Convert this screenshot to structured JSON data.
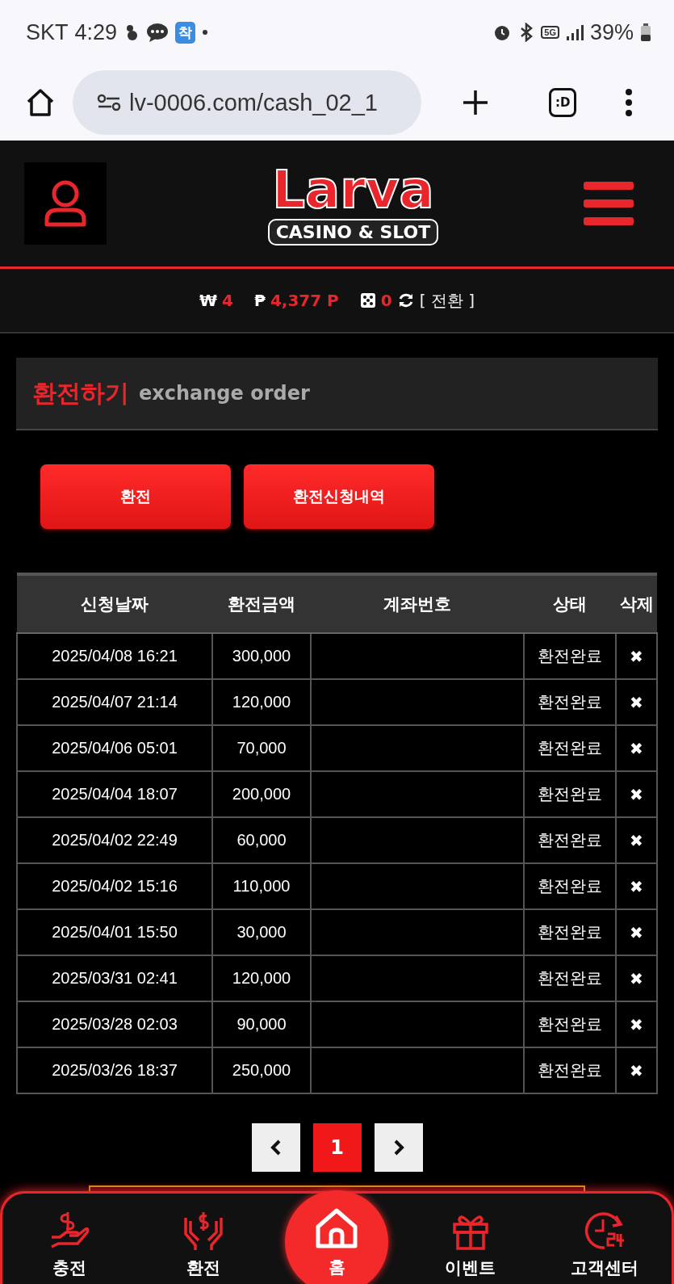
{
  "status_bar": {
    "carrier": "SKT",
    "time": "4:29",
    "app_badge": "착",
    "network": "5G",
    "battery": "39%"
  },
  "browser": {
    "url": "lv-0006.com/cash_02_1",
    "tab_label": ":D"
  },
  "logo": {
    "title": "Larva",
    "subtitle": "CASINO & SLOT"
  },
  "balance": {
    "won_symbol": "₩",
    "won": "4",
    "point_symbol": "₱",
    "points": "4,377 P",
    "chips": "0",
    "convert": "[ 전환 ]"
  },
  "section": {
    "title": "환전하기",
    "subtitle": "exchange order"
  },
  "buttons": [
    {
      "label": "환전"
    },
    {
      "label": "환전신청내역"
    }
  ],
  "table": {
    "columns": [
      "신청날짜",
      "환전금액",
      "계좌번호",
      "상태",
      "삭제"
    ],
    "rows": [
      {
        "date": "2025/04/08 16:21",
        "amount": "300,000",
        "status": "환전완료",
        "delete": "✖"
      },
      {
        "date": "2025/04/07 21:14",
        "amount": "120,000",
        "status": "환전완료",
        "delete": "✖"
      },
      {
        "date": "2025/04/06 05:01",
        "amount": "70,000",
        "status": "환전완료",
        "delete": "✖"
      },
      {
        "date": "2025/04/04 18:07",
        "amount": "200,000",
        "status": "환전완료",
        "delete": "✖"
      },
      {
        "date": "2025/04/02 22:49",
        "amount": "60,000",
        "status": "환전완료",
        "delete": "✖"
      },
      {
        "date": "2025/04/02 15:16",
        "amount": "110,000",
        "status": "환전완료",
        "delete": "✖"
      },
      {
        "date": "2025/04/01 15:50",
        "amount": "30,000",
        "status": "환전완료",
        "delete": "✖"
      },
      {
        "date": "2025/03/31 02:41",
        "amount": "120,000",
        "status": "환전완료",
        "delete": "✖"
      },
      {
        "date": "2025/03/28 02:03",
        "amount": "90,000",
        "status": "환전완료",
        "delete": "✖"
      },
      {
        "date": "2025/03/26 18:37",
        "amount": "250,000",
        "status": "환전완료",
        "delete": "✖"
      }
    ]
  },
  "pagination": {
    "pages": [
      {
        "label": "1",
        "selected": true
      }
    ]
  },
  "bottom_nav": [
    {
      "kind": "charge",
      "label": "충전"
    },
    {
      "kind": "exchange",
      "label": "환전"
    },
    {
      "kind": "home",
      "label": "홈"
    },
    {
      "kind": "event",
      "label": "이벤트"
    },
    {
      "kind": "support",
      "label": "고객센터"
    }
  ]
}
